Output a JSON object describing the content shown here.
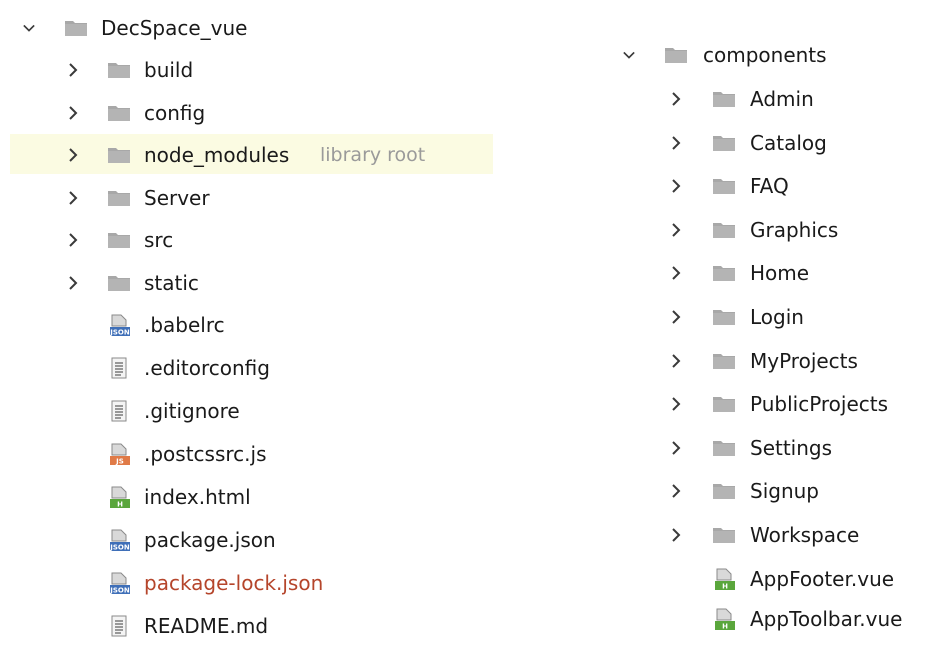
{
  "left_tree": {
    "root": {
      "label": "DecSpace_vue",
      "icon": "folder-icon",
      "expanded": true
    },
    "folders": [
      {
        "label": "build",
        "icon": "folder-icon"
      },
      {
        "label": "config",
        "icon": "folder-icon"
      },
      {
        "label": "node_modules",
        "hint": "library root",
        "icon": "folder-icon",
        "highlighted": true
      },
      {
        "label": "Server",
        "icon": "folder-icon"
      },
      {
        "label": "src",
        "icon": "folder-icon"
      },
      {
        "label": "static",
        "icon": "folder-icon"
      }
    ],
    "files": [
      {
        "label": ".babelrc",
        "icon": "json-file-icon"
      },
      {
        "label": ".editorconfig",
        "icon": "text-file-icon"
      },
      {
        "label": ".gitignore",
        "icon": "text-file-icon"
      },
      {
        "label": ".postcssrc.js",
        "icon": "js-file-icon"
      },
      {
        "label": "index.html",
        "icon": "html-file-icon"
      },
      {
        "label": "package.json",
        "icon": "json-file-icon"
      },
      {
        "label": "package-lock.json",
        "icon": "json-file-icon",
        "modified": true
      },
      {
        "label": "README.md",
        "icon": "text-file-icon"
      }
    ]
  },
  "right_tree": {
    "root": {
      "label": "components",
      "icon": "folder-icon",
      "expanded": true
    },
    "folders": [
      {
        "label": "Admin"
      },
      {
        "label": "Catalog"
      },
      {
        "label": "FAQ"
      },
      {
        "label": "Graphics"
      },
      {
        "label": "Home"
      },
      {
        "label": "Login"
      },
      {
        "label": "MyProjects"
      },
      {
        "label": "PublicProjects"
      },
      {
        "label": "Settings"
      },
      {
        "label": "Signup"
      },
      {
        "label": "Workspace"
      }
    ],
    "files": [
      {
        "label": "AppFooter.vue",
        "icon": "vue-file-icon"
      },
      {
        "label": "AppToolbar.vue",
        "icon": "vue-file-icon"
      }
    ]
  },
  "icon_badges": {
    "json": "JSON",
    "js": "JS",
    "html": "H"
  },
  "colors": {
    "folder": "#a8a8a8",
    "highlight_row": "#fbfbe2",
    "modified_text": "#b5452b",
    "hint_text": "#9a9a9a",
    "json_badge": "#3f6fb8",
    "js_badge": "#e07a47",
    "html_badge": "#5aa63c"
  }
}
